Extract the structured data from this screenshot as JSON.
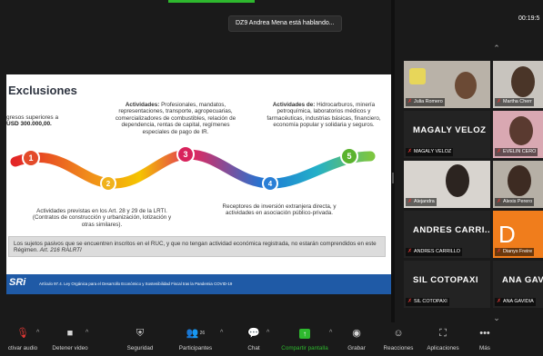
{
  "topbar": {
    "speaking_banner": "DZ9 Andrea Mena  está hablando...",
    "timer": "00:19:5"
  },
  "slide": {
    "title": "Exclusiones",
    "left_income": "gresos superiores a",
    "left_amount": "USD 300.000,00.",
    "activities1_label": "Actividades:",
    "activities1_text": "Profesionales, mandatos, representaciones, transporte, agropecuarias, comercializadores de combustibles, relación de dependencia, rentas de capital, regímenes especiales de pago de IR.",
    "activities2_label": "Actividades de:",
    "activities2_text": "Hidrocarburos, minería petroquímica, laboratorios médicos y farmacéuticas, industrias básicas, financiero, economía popular y solidaria y seguros.",
    "bottom1": "Actividades previstas en los Art. 28 y 29 de la LRTI. (Contratos de construcción y urbanización, lotización y otras similares).",
    "bottom2": "Receptores de inversión extranjera directa, y actividades en asociación público-privada.",
    "steps": [
      "1",
      "2",
      "3",
      "4",
      "5"
    ],
    "note": "Los sujetos pasivos que se encuentren inscritos en el RUC, y que no tengan actividad económica registrada, no estarán comprendidos en este Régimen.",
    "note_ref": "Art. 216 RALRTI",
    "footer_logo": "SRi",
    "footer_text": "Artículo 97.4. Ley Orgánica para el Desarrollo Económico y Sostenibilidad Fiscal tras la Pandemia COVID-19"
  },
  "gallery": {
    "tiles": [
      {
        "name": "Julia Romero",
        "type": "video"
      },
      {
        "name": "Martha Cherr",
        "type": "video"
      },
      {
        "name": "MAGALY VELOZ",
        "type": "name",
        "big": "MAGALY VELOZ"
      },
      {
        "name": "EVELIN CERO",
        "type": "video"
      },
      {
        "name": "Alejandra",
        "type": "video"
      },
      {
        "name": "Alexis Perero",
        "type": "video"
      },
      {
        "name": "ANDRES CARRILLO",
        "type": "name",
        "big": "ANDRES  CARRI..."
      },
      {
        "name": "Dianys Freire",
        "type": "avatar",
        "letter": "D"
      },
      {
        "name": "SIL COTOPAXI",
        "type": "name",
        "big": "SIL COTOPAXI"
      },
      {
        "name": "ANA GAVIDIA",
        "type": "name",
        "big": "ANA GAV"
      }
    ]
  },
  "toolbar": {
    "audio": "ctivar audio",
    "video": "Detener video",
    "security": "Seguridad",
    "participants": "Participantes",
    "participants_count": "26",
    "chat": "Chat",
    "share": "Compartir pantalla",
    "record": "Grabar",
    "reactions": "Reacciones",
    "apps": "Aplicaciones",
    "more": "Más"
  },
  "colors": {
    "accent_green": "#2eb82e",
    "footer_blue": "#1f5aa6",
    "mic_muted": "#e53935",
    "avatar_orange": "#f07d1c"
  }
}
